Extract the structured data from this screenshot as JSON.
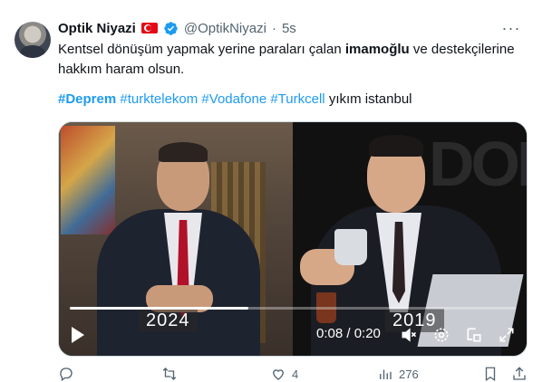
{
  "tweet": {
    "author_name": "Optik Niyazi",
    "handle": "@OptikNiyazi",
    "separator": "·",
    "time": "5s",
    "text_before": "Kentsel dönüşüm yapmak yerine paraları çalan ",
    "text_bold": "imamoğlu",
    "text_after": " ve destekçilerine hakkım haram olsun.",
    "hashtags": [
      "#Deprem",
      "#turktelekom",
      "#Vodafone",
      "#Turkcell"
    ],
    "hashtags_tail": "yıkım istanbul",
    "more_label": "···"
  },
  "video": {
    "year_left": "2024",
    "year_right": "2019",
    "background_text": "DOL",
    "timecode": "0:08 / 0:20",
    "progress_fraction": 0.4
  },
  "actions": {
    "reply_count": "",
    "retweet_count": "",
    "like_count": "4",
    "views_count": "276"
  },
  "colors": {
    "link": "#1d9bf0",
    "muted": "#536471",
    "text": "#0f1419"
  },
  "icons": [
    "avatar",
    "turkish-flag-icon",
    "verified-badge-icon",
    "more-icon",
    "play-icon",
    "volume-icon",
    "settings-icon",
    "pip-icon",
    "fullscreen-icon",
    "reply-icon",
    "retweet-icon",
    "like-icon",
    "views-icon",
    "bookmark-icon",
    "share-icon"
  ]
}
